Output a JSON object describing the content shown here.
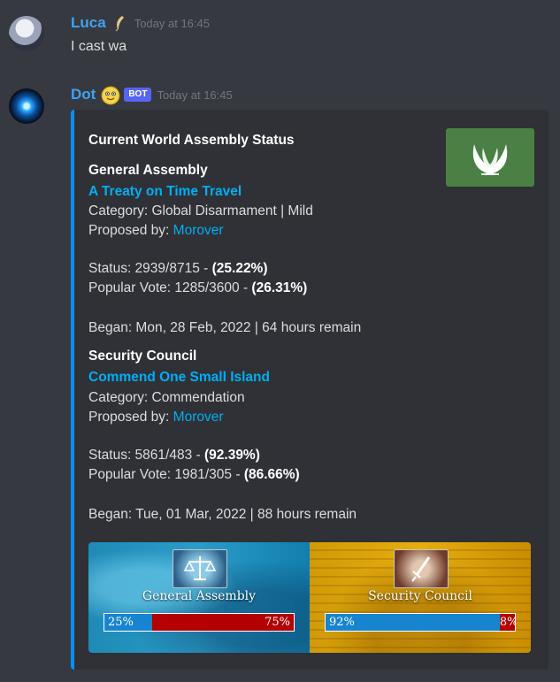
{
  "messages": [
    {
      "author": "Luca",
      "author_color": "#3ea2f5",
      "badge_icon": "feather-icon",
      "timestamp": "Today at 16:45",
      "content": "I cast wa"
    },
    {
      "author": "Dot",
      "author_color": "#3ea2f5",
      "badge_icon": "smiling-emoji-icon",
      "bot_tag": "BOT",
      "timestamp": "Today at 16:45"
    }
  ],
  "embed": {
    "accent_color": "#0c8ef0",
    "title": "Current World Assembly Status",
    "thumbnail_icon": "world-assembly-laurel-icon",
    "general_assembly": {
      "heading": "General Assembly",
      "resolution": "A Treaty on Time Travel",
      "category": "Category: Global Disarmament | Mild",
      "proposed_label": "Proposed by: ",
      "proposer": "Morover",
      "status_label": "Status: 2939/8715 - ",
      "status_pct": "(25.22%)",
      "popular_label": "Popular Vote: 1285/3600 - ",
      "popular_pct": "(26.31%)",
      "began": "Began: Mon, 28 Feb, 2022 | 64 hours remain"
    },
    "security_council": {
      "heading": "Security Council",
      "resolution": "Commend One Small Island",
      "category": "Category: Commendation",
      "proposed_label": "Proposed by: ",
      "proposer": "Morover",
      "status_label": "Status: 5861/483 - ",
      "status_pct": "(92.39%)",
      "popular_label": "Popular Vote: 1981/305 - ",
      "popular_pct": "(86.66%)",
      "began": "Began: Tue, 01 Mar, 2022 | 88 hours remain"
    },
    "banner": {
      "ga_label": "General Assembly",
      "ga_icon": "scales-of-justice-icon",
      "ga_for_label": "25%",
      "ga_against_label": "75%",
      "ga_for_fraction": 0.25,
      "sc_label": "Security Council",
      "sc_icon": "sword-icon",
      "sc_for_label": "92%",
      "sc_against_label": "8%",
      "sc_for_fraction": 0.92,
      "for_color": "#1784d0",
      "against_color": "#b40000"
    }
  }
}
